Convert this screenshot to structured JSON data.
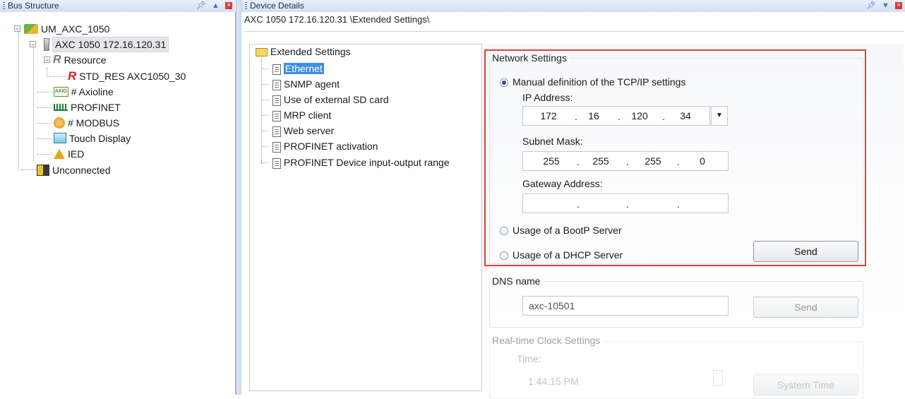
{
  "left_panel": {
    "title": "Bus Structure",
    "tree": {
      "root": "UM_AXC_1050",
      "device": "AXC 1050 172.16.120.31",
      "resource": "Resource",
      "std_res": "STD_RES AXC1050_30",
      "axioline": "# Axioline",
      "axio_icon_text": "AXIO",
      "profinet": "PROFINET",
      "modbus": "# MODBUS",
      "touch": "Touch Display",
      "ied": "IED",
      "unconnected": "Unconnected"
    }
  },
  "right_panel": {
    "title": "Device Details",
    "path": "AXC 1050 172.16.120.31 \\Extended Settings\\",
    "settings_tree": {
      "root": "Extended Settings",
      "items": [
        "Ethernet",
        "SNMP agent",
        "Use of external SD card",
        "MRP client",
        "Web server",
        "PROFINET activation",
        "PROFINET Device input-output range"
      ],
      "selected_index": 0
    },
    "network": {
      "title": "Network Settings",
      "manual_label": "Manual definition of the TCP/IP settings",
      "ip_label": "IP Address:",
      "ip": [
        "172",
        "16",
        "120",
        "34"
      ],
      "subnet_label": "Subnet Mask:",
      "subnet": [
        "255",
        "255",
        "255",
        "0"
      ],
      "gateway_label": "Gateway Address:",
      "gateway": [
        "",
        "",
        "",
        ""
      ],
      "bootp_label": "Usage of a BootP Server",
      "dhcp_label": "Usage of a DHCP Server",
      "send_label": "Send",
      "selected_option": "manual"
    },
    "dns": {
      "title": "DNS name",
      "value": "axc-10501",
      "send_label": "Send"
    },
    "rtc": {
      "title": "Real-time Clock Settings",
      "time_label": "Time:",
      "time_value": "1:44:15 PM",
      "system_time_label": "System Time"
    }
  },
  "colors": {
    "selection": "#3d8ee6",
    "highlight_frame": "#e04040",
    "header_bg": "#d3e0f1"
  }
}
